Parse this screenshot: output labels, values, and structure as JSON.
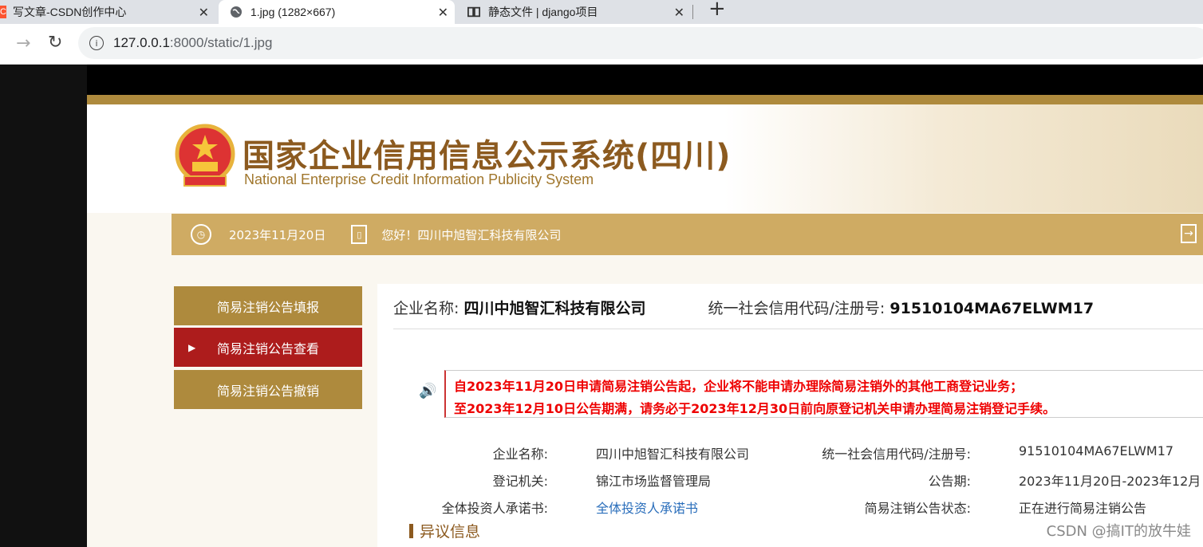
{
  "tabs": [
    {
      "label": "写文章-CSDN创作中心"
    },
    {
      "label": "1.jpg (1282×667)"
    },
    {
      "label": "静态文件 | django项目"
    }
  ],
  "tab_close": "✕",
  "tab_add": "+",
  "url": {
    "host": "127.0.0.1",
    "rest": ":8000/static/1.jpg"
  },
  "site": {
    "title_cn": "国家企业信用信息公示系统(四川)",
    "title_en": "National Enterprise Credit Information Publicity System"
  },
  "infobar": {
    "date": "2023年11月20日",
    "greeting": "您好！四川中旭智汇科技有限公司"
  },
  "menu": [
    {
      "label": "简易注销公告填报"
    },
    {
      "label": "简易注销公告查看"
    },
    {
      "label": "简易注销公告撤销"
    }
  ],
  "summary": {
    "company_label": "企业名称:",
    "company_value": "四川中旭智汇科技有限公司",
    "code_label": "统一社会信用代码/注册号:",
    "code_value": "91510104MA67ELWM17"
  },
  "notice": [
    "自2023年11月20日申请简易注销公告起，企业将不能申请办理除简易注销外的其他工商登记业务；",
    "至2023年12月10日公告期满，请务必于2023年12月30日前向原登记机关申请办理简易注销登记手续。"
  ],
  "details": {
    "name_label": "企业名称:",
    "name_value": "四川中旭智汇科技有限公司",
    "code_label": "统一社会信用代码/注册号:",
    "code_value": "91510104MA67ELWM17",
    "org_label": "登记机关:",
    "org_value": "锦江市场监督管理局",
    "period_label": "公告期:",
    "period_value": "2023年11月20日-2023年12月",
    "commit_label": "全体投资人承诺书:",
    "commit_value": "全体投资人承诺书",
    "status_label": "简易注销公告状态:",
    "status_value": "正在进行简易注销公告"
  },
  "objection": "异议信息",
  "watermark": "CSDN @搞IT的放牛娃"
}
